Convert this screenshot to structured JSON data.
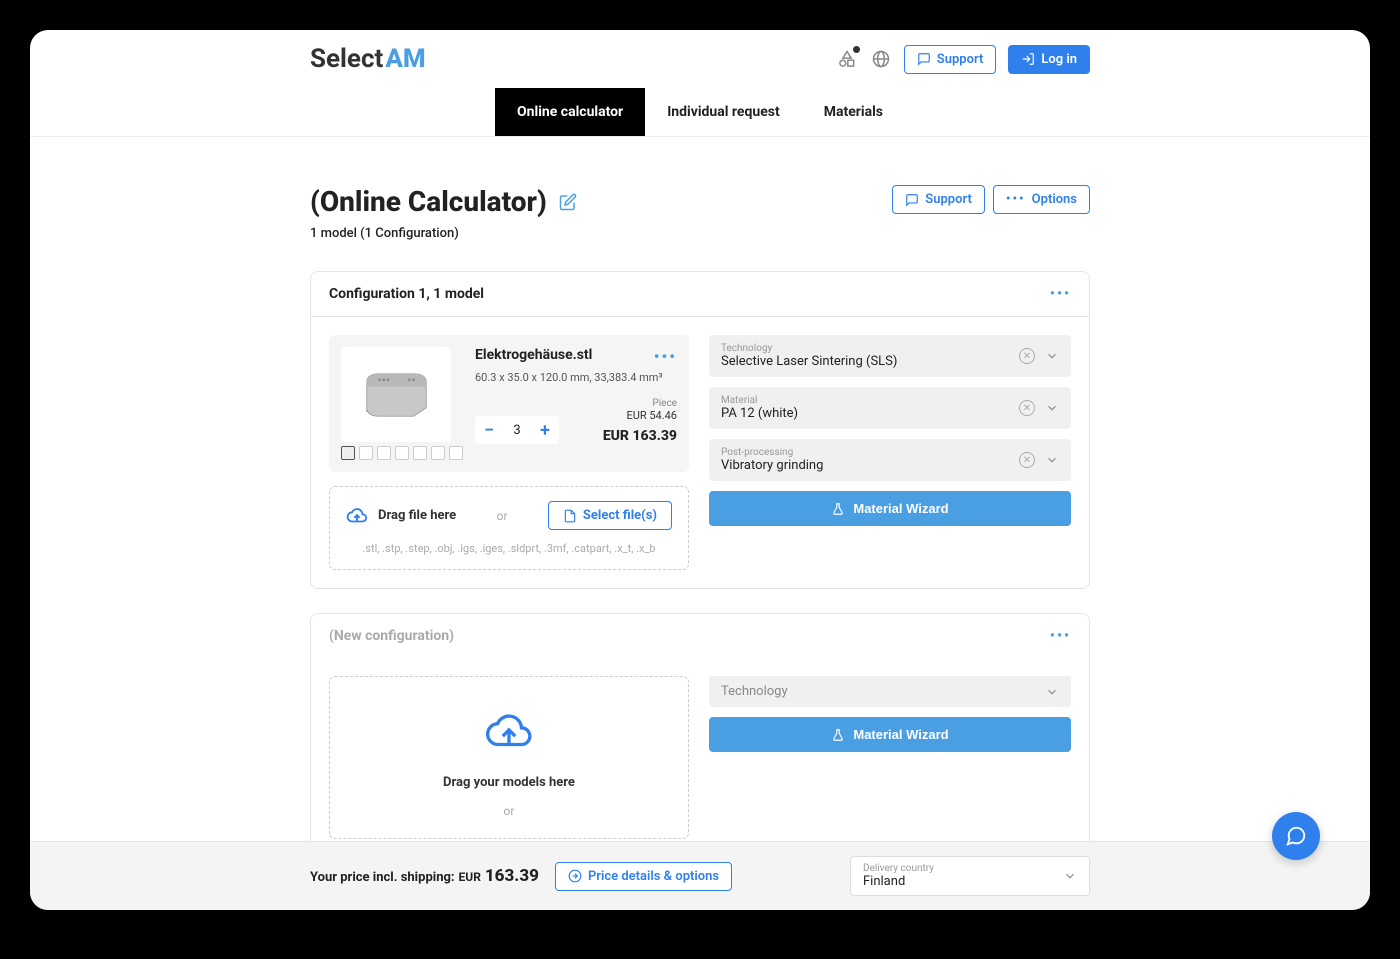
{
  "logo": {
    "part1": "Select",
    "part2": "AM"
  },
  "header": {
    "support": "Support",
    "login": "Log in"
  },
  "nav": {
    "online_calc": "Online calculator",
    "individual": "Individual request",
    "materials": "Materials"
  },
  "page": {
    "title": "(Online Calculator)",
    "subtitle": "1 model (1 Configuration)",
    "support_btn": "Support",
    "options_btn": "Options"
  },
  "config1": {
    "header": "Configuration 1, 1 model",
    "model": {
      "name": "Elektrogehäuse.stl",
      "dims": "60.3 x 35.0 x 120.0 mm, 33,383.4 mm³",
      "qty": "3",
      "piece_label": "Piece",
      "piece_price": "EUR 54.46",
      "total_price": "EUR 163.39"
    },
    "upload": {
      "drag": "Drag file here",
      "or": "or",
      "select": "Select file(s)",
      "types": ".stl, .stp, .step, .obj, .igs, .iges, .sldprt, .3mf, .catpart, .x_t, .x_b"
    },
    "selects": {
      "tech_label": "Technology",
      "tech_value": "Selective Laser Sintering (SLS)",
      "mat_label": "Material",
      "mat_value": "PA 12 (white)",
      "post_label": "Post-processing",
      "post_value": "Vibratory grinding"
    },
    "wizard": "Material Wizard"
  },
  "config2": {
    "header": "(New configuration)",
    "drag": "Drag your models here",
    "or": "or",
    "tech_placeholder": "Technology",
    "wizard": "Material Wizard"
  },
  "footer": {
    "price_label": "Your price incl. shipping:",
    "currency": "EUR",
    "amount": "163.39",
    "details_btn": "Price details & options",
    "delivery_label": "Delivery country",
    "delivery_value": "Finland"
  }
}
